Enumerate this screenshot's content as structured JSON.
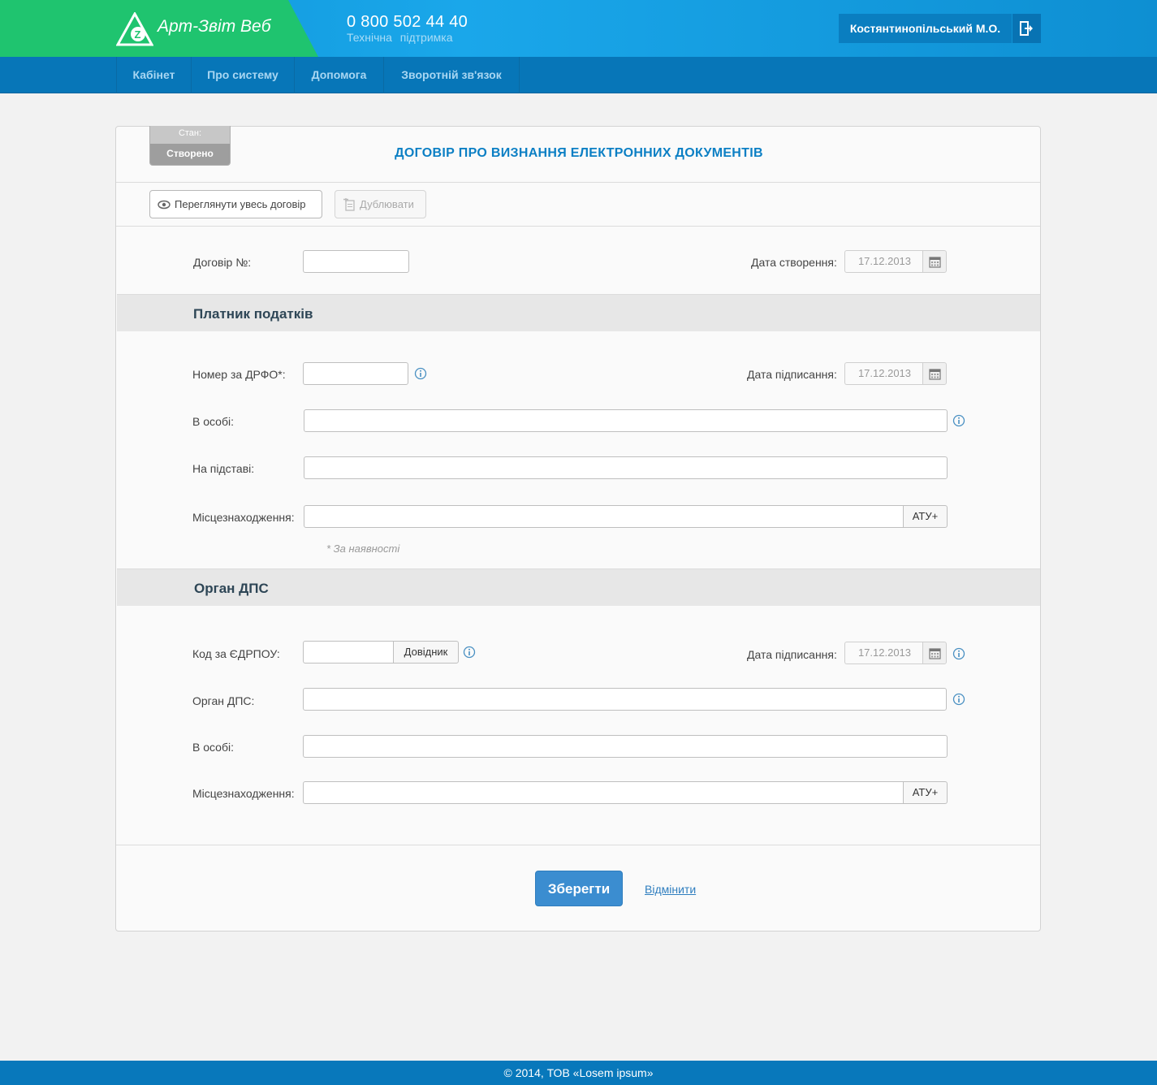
{
  "header": {
    "brand_name": "Арт-Звіт Веб",
    "phone": "0 800 502 44 40",
    "phone_caption": "Технічна  підтримка",
    "user_name": "Костянтинопільський М.О."
  },
  "nav": {
    "items": [
      {
        "label": "Кабінет"
      },
      {
        "label": "Про систему"
      },
      {
        "label": "Допомога"
      },
      {
        "label": "Зворотній зв'язок"
      }
    ]
  },
  "document": {
    "status_label": "Стан:",
    "status_value": "Створено",
    "title": "ДОГОВІР ПРО ВИЗНАННЯ ЕЛЕКТРОННИХ ДОКУМЕНТІВ",
    "view_button": "Переглянути увесь договір",
    "duplicate_button": "Дублювати",
    "contract_no_label": "Договір №:",
    "contract_no_value": "",
    "created_date_label": "Дата створення:",
    "created_date": "17.12.2013"
  },
  "taxpayer": {
    "section_title": "Платник податків",
    "drfo_label": "Номер за ДРФО*:",
    "drfo_value": "",
    "signed_date_label": "Дата підписання:",
    "signed_date": "17.12.2013",
    "person_label": "В особі:",
    "person_value": "",
    "basis_label": "На підставі:",
    "basis_value": "",
    "location_label": "Місцезнаходження:",
    "location_value": "",
    "atu_button": "АТУ+",
    "note": "* За наявності"
  },
  "tax_office": {
    "section_title": "Орган ДПС",
    "edrpou_label": "Код за ЄДРПОУ:",
    "edrpou_value": "",
    "directory_button": "Довідник",
    "signed_date_label": "Дата підписання:",
    "signed_date": "17.12.2013",
    "office_label": "Орган ДПС:",
    "office_value": "",
    "person_label": "В особі:",
    "person_value": "",
    "location_label": "Місцезнаходження:",
    "location_value": "",
    "atu_button": "АТУ+"
  },
  "actions": {
    "save": "Зберегти",
    "cancel": "Відмінити"
  },
  "footer": {
    "copyright": "© 2014, ТОВ «Losem ipsum»"
  },
  "colors": {
    "header_blue": "#1aa7ea",
    "brand_green": "#1fc46f",
    "nav_blue": "#0776b8",
    "title_blue": "#0b7fc4",
    "save_button": "#3b8dd0"
  },
  "icons": [
    "logo-icon",
    "logout-icon",
    "eye-icon",
    "duplicate-icon",
    "calendar-icon",
    "info-icon"
  ]
}
